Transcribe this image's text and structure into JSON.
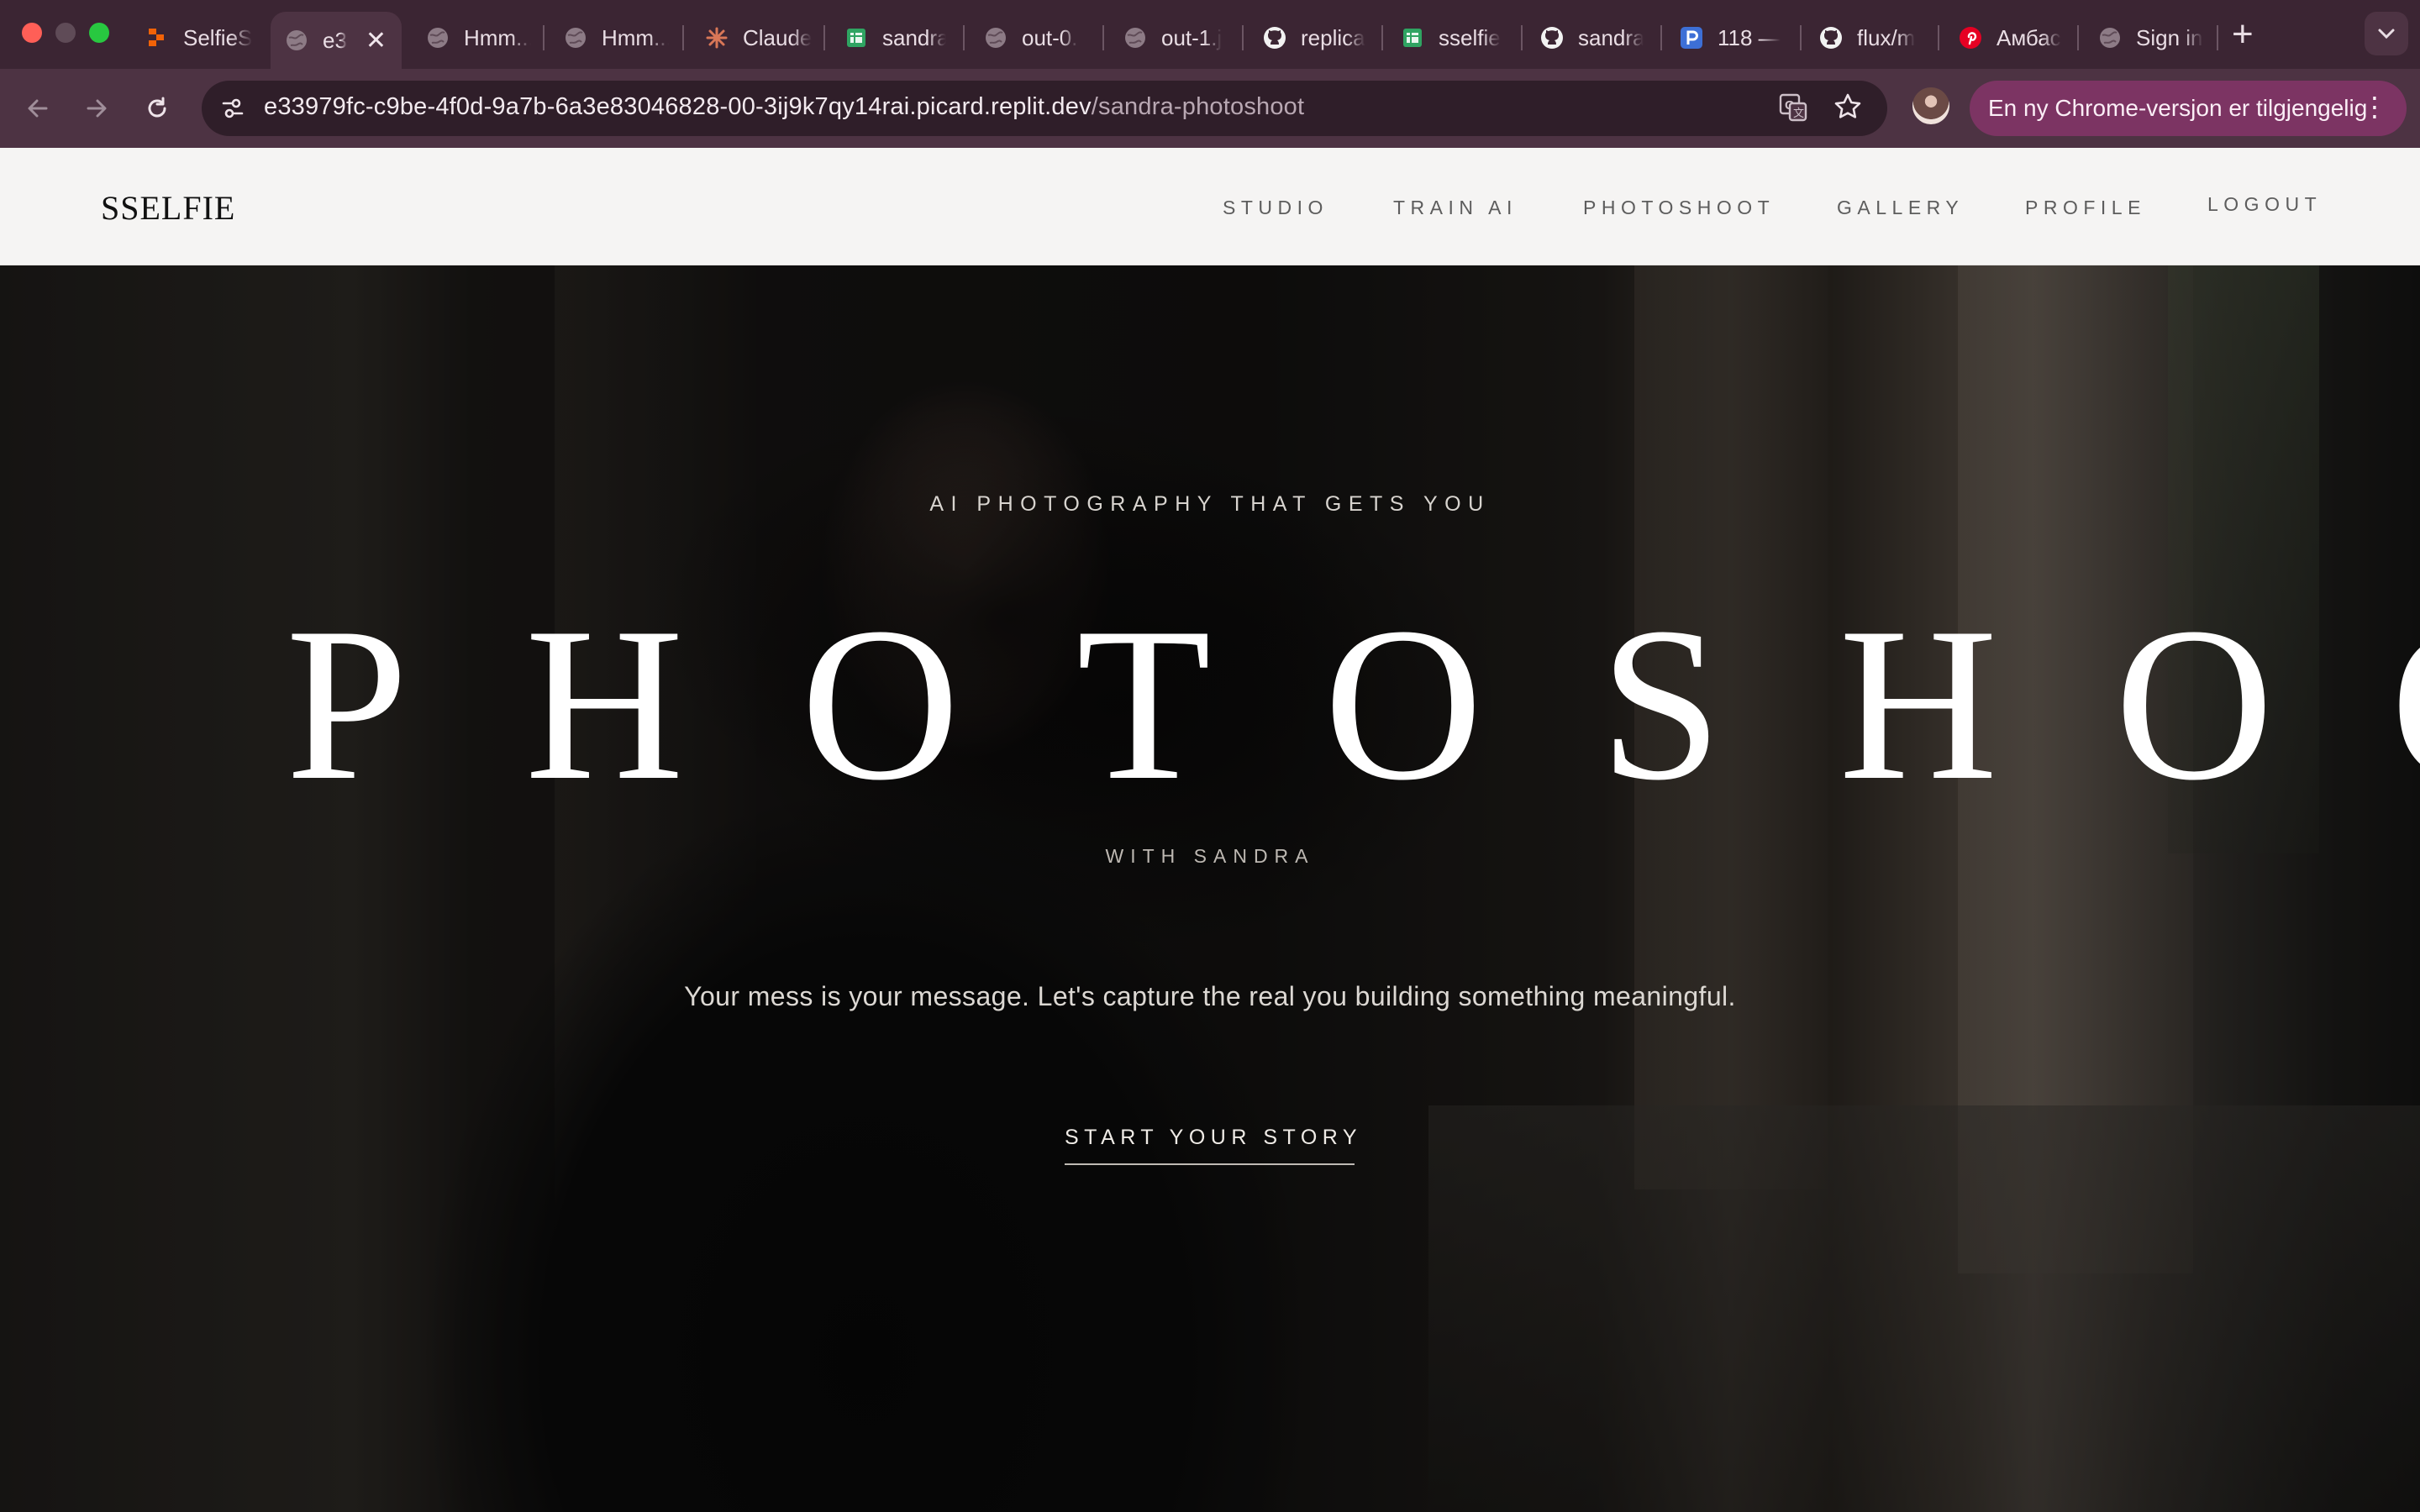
{
  "browser": {
    "tabs": [
      {
        "label": "SelfieS",
        "icon": "replit-icon"
      },
      {
        "label": "e3",
        "icon": "globe-icon",
        "active": true
      },
      {
        "label": "Hmm...",
        "icon": "globe-icon"
      },
      {
        "label": "Hmm...",
        "icon": "globe-icon"
      },
      {
        "label": "Claude",
        "icon": "claude-icon"
      },
      {
        "label": "sandra",
        "icon": "sheets-icon"
      },
      {
        "label": "out-0.",
        "icon": "globe-icon"
      },
      {
        "label": "out-1.j",
        "icon": "globe-icon"
      },
      {
        "label": "replica",
        "icon": "github-icon"
      },
      {
        "label": "sselfie",
        "icon": "sheets-icon"
      },
      {
        "label": "sandra",
        "icon": "github-icon"
      },
      {
        "label": "118 —",
        "icon": "p-icon"
      },
      {
        "label": "flux/m",
        "icon": "github-icon"
      },
      {
        "label": "Амбас",
        "icon": "pinterest-icon"
      },
      {
        "label": "Sign in",
        "icon": "globe-icon"
      }
    ],
    "new_tab_label": "+",
    "url_host": "e33979fc-c9be-4f0d-9a7b-6a3e83046828-00-3ij9k7qy14rai.picard.replit.dev",
    "url_path": "/sandra-photoshoot",
    "update_label": "En ny Chrome-versjon er tilgjengelig",
    "colors": {
      "tabstrip": "#3b2533",
      "toolbar": "#4d3343",
      "update_pill": "#7c3463"
    }
  },
  "site": {
    "logo": "SSELFIE",
    "nav": [
      "STUDIO",
      "TRAIN AI",
      "PHOTOSHOOT",
      "GALLERY",
      "PROFILE",
      "LOGOUT"
    ]
  },
  "hero": {
    "eyebrow": "AI PHOTOGRAPHY THAT GETS YOU",
    "title": "PHOTOSHOOT",
    "subtitle": "WITH SANDRA",
    "tagline": "Your mess is your message. Let's capture the real you building something meaningful.",
    "cta": "START YOUR STORY"
  }
}
